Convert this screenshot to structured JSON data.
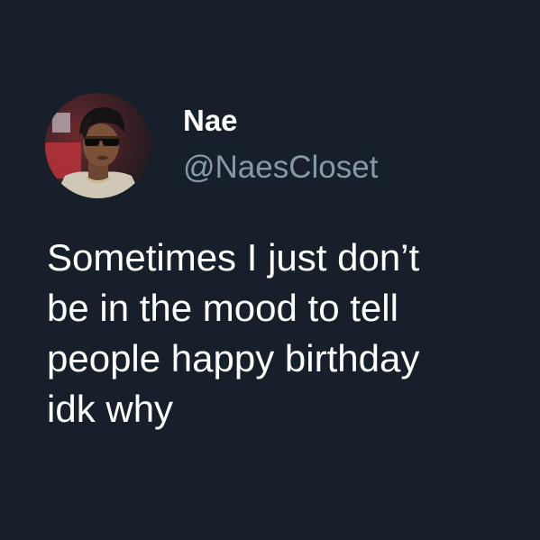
{
  "theme": {
    "background": "#17202a",
    "text_color": "#ffffff",
    "handle_color": "#8899a6"
  },
  "profile": {
    "avatar_icon": "profile-photo-avatar",
    "display_name": "Nae",
    "handle": "@NaesCloset"
  },
  "tweet": {
    "lines": [
      "Sometimes I just don’t",
      "be in the mood to tell",
      "people happy birthday",
      "idk why"
    ]
  }
}
